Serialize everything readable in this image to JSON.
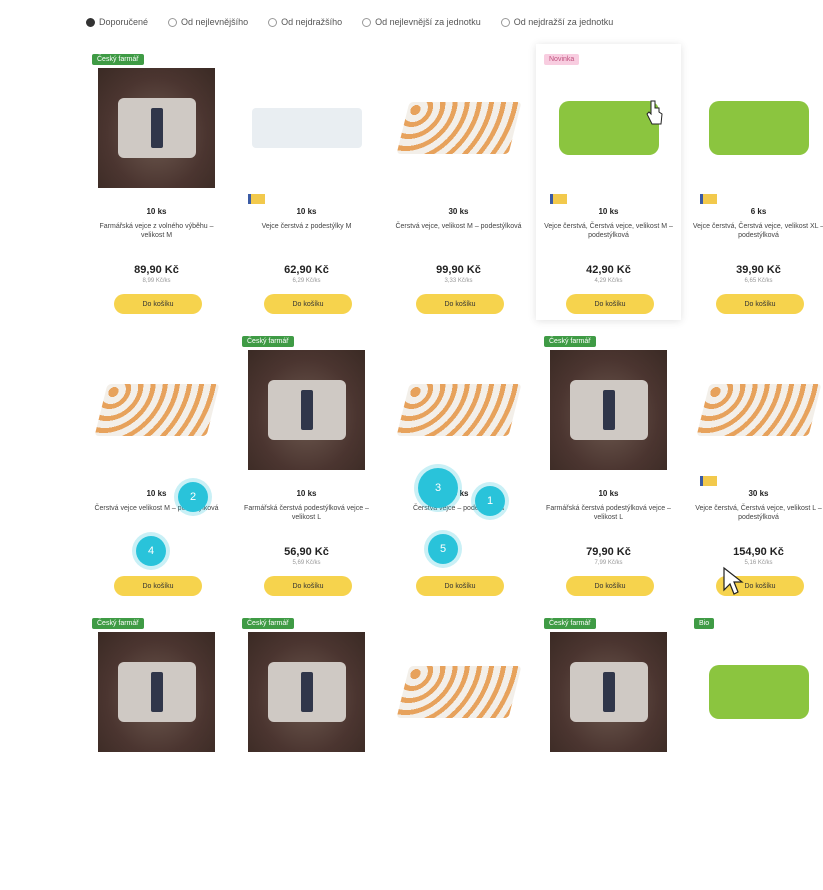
{
  "sort": {
    "options": [
      "Doporučené",
      "Od nejlevnějšího",
      "Od nejdražšího",
      "Od nejlevnější za jednotku",
      "Od nejdražší za jednotku"
    ],
    "selected": 0
  },
  "rows": [
    [
      {
        "badge": "Český farmář",
        "badge_color": "green",
        "image": "photo",
        "eu": false,
        "weight": "10 ks",
        "name": "Farmářská vejce z volného výběhu – velikost M",
        "price": "89,90 Kč",
        "unit": "8,99 Kč/ks",
        "button": "Do košíku"
      },
      {
        "badge": "",
        "image": "pack",
        "eu": true,
        "weight": "10 ks",
        "name": "Vejce čerstvá z podestýlky M",
        "price": "62,90 Kč",
        "unit": "6,29 Kč/ks",
        "button": "Do košíku"
      },
      {
        "badge": "",
        "image": "tray",
        "eu": false,
        "weight": "30 ks",
        "name": "Čerstvá vejce, velikost M – podestýlková",
        "price": "99,90 Kč",
        "unit": "3,33 Kč/ks",
        "button": "Do košíku"
      },
      {
        "badge": "Novinka",
        "badge_color": "pink",
        "image": "greenbox",
        "eu": true,
        "weight": "10 ks",
        "name": "Vejce čerstvá, Čerstvá vejce, velikost M – podestýlková",
        "price": "42,90 Kč",
        "unit": "4,29 Kč/ks",
        "button": "Do košíku",
        "hover": true
      },
      {
        "badge": "",
        "image": "greenbox",
        "eu": true,
        "weight": "6 ks",
        "name": "Vejce čerstvá, Čerstvá vejce, velikost XL – podestýlková",
        "price": "39,90 Kč",
        "unit": "6,65 Kč/ks",
        "button": "Do košíku"
      }
    ],
    [
      {
        "badge": "",
        "image": "tray",
        "eu": false,
        "weight": "10 ks",
        "name": "Čerstvá vejce velikost M – podestýlková",
        "price": "",
        "unit": "",
        "button": "Do košíku"
      },
      {
        "badge": "Český farmář",
        "badge_color": "green",
        "image": "photo",
        "eu": false,
        "weight": "10 ks",
        "name": "Farmářská čerstvá podestýlková vejce – velikost L",
        "price": "56,90 Kč",
        "unit": "5,69 Kč/ks",
        "button": "Do košíku"
      },
      {
        "badge": "",
        "image": "tray",
        "eu": false,
        "weight": "30 ks",
        "name": "Čerstvá vejce – podestýlková",
        "price": "",
        "unit": "",
        "button": "Do košíku"
      },
      {
        "badge": "Český farmář",
        "badge_color": "green",
        "image": "photo",
        "eu": false,
        "weight": "10 ks",
        "name": "Farmářská čerstvá podestýlková vejce – velikost L",
        "price": "79,90 Kč",
        "unit": "7,99 Kč/ks",
        "button": "Do košíku"
      },
      {
        "badge": "",
        "image": "tray",
        "eu": true,
        "weight": "30 ks",
        "name": "Vejce čerstvá, Čerstvá vejce, velikost L – podestýlková",
        "price": "154,90 Kč",
        "unit": "5,16 Kč/ks",
        "button": "Do košíku"
      }
    ],
    [
      {
        "badge": "Český farmář",
        "badge_color": "green",
        "image": "photo"
      },
      {
        "badge": "Český farmář",
        "badge_color": "green",
        "image": "photo"
      },
      {
        "badge": "",
        "image": "tray"
      },
      {
        "badge": "Český farmář",
        "badge_color": "green",
        "image": "photo"
      },
      {
        "badge": "Bio",
        "badge_color": "green",
        "image": "greenbox"
      }
    ]
  ],
  "steps": [
    {
      "label": "1"
    },
    {
      "label": "2"
    },
    {
      "label": "3"
    },
    {
      "label": "4"
    },
    {
      "label": "5"
    }
  ]
}
